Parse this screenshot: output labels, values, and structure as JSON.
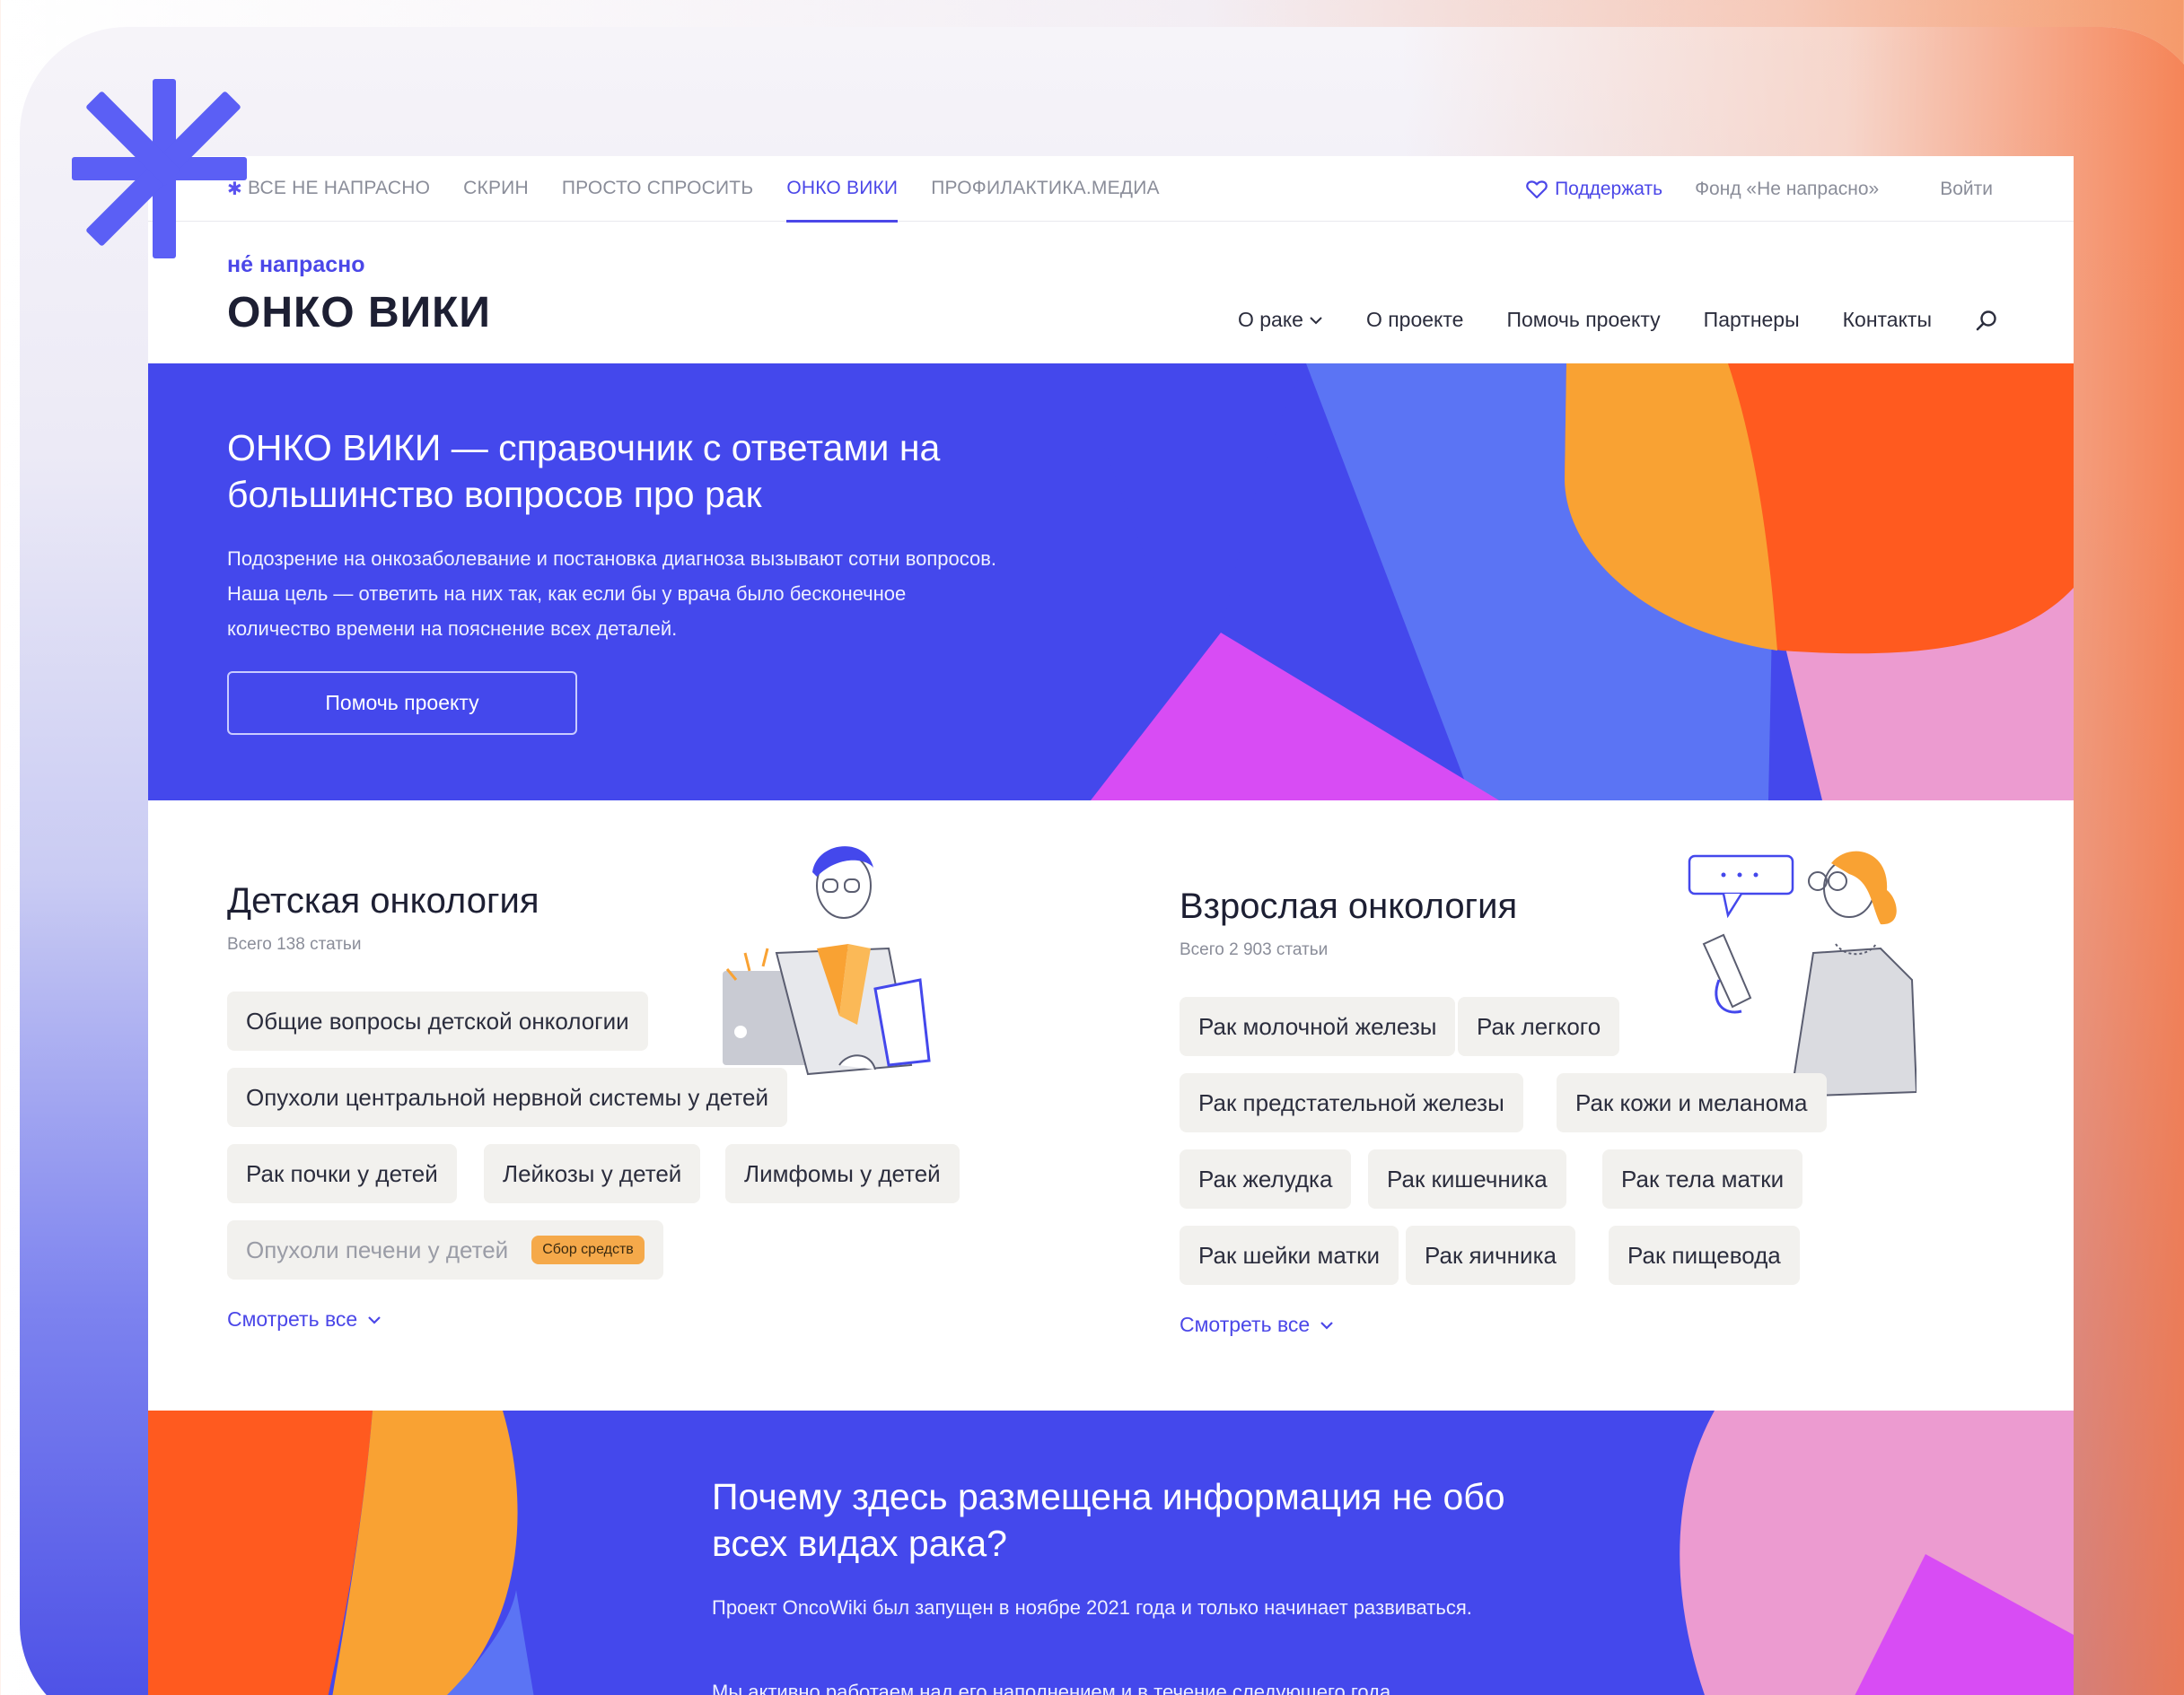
{
  "network": {
    "items": [
      {
        "label": "ВСЕ НЕ НАПРАСНО",
        "active": false
      },
      {
        "label": "СКРИН",
        "active": false
      },
      {
        "label": "ПРОСТО СПРОСИТЬ",
        "active": false
      },
      {
        "label": "ОНКО ВИКИ",
        "active": true
      },
      {
        "label": "ПРОФИЛАКТИКА.МЕДИА",
        "active": false
      }
    ],
    "support": "Поддержать",
    "fund": "Фонд «Не напрасно»",
    "login": "Войти"
  },
  "header": {
    "brand_small": "не́ напрасно",
    "brand_title": "ОНКО ВИКИ",
    "nav": [
      "О раке",
      "О проекте",
      "Помочь проекту",
      "Партнеры",
      "Контакты"
    ]
  },
  "hero": {
    "title": "ОНКО ВИКИ — справочник с ответами на большинство вопросов про рак",
    "text": "Подозрение на онкозаболевание и постановка диагноза вызывают сотни вопросов. Наша цель — ответить на них так, как если бы у врача было бесконечное количество времени на пояснение всех деталей.",
    "button": "Помочь проекту"
  },
  "children": {
    "title": "Детская онкология",
    "count": "Всего 138 статьи",
    "chips": [
      "Общие вопросы детской онкологии",
      "Опухоли центральной нервной системы у детей",
      "Рак почки у детей",
      "Лейкозы у детей",
      "Лимфомы у детей",
      "Опухоли печени у детей"
    ],
    "badge": "Сбор средств",
    "see_all": "Смотреть все"
  },
  "adults": {
    "title": "Взрослая онкология",
    "count": "Всего 2 903 статьи",
    "chips": [
      "Рак молочной железы",
      "Рак легкого",
      "Рак предстательной железы",
      "Рак кожи и меланома",
      "Рак желудка",
      "Рак кишечника",
      "Рак тела матки",
      "Рак шейки матки",
      "Рак яичника",
      "Рак пищевода"
    ],
    "see_all": "Смотреть все"
  },
  "why": {
    "title": "Почему здесь размещена информация не обо всех видах рака?",
    "p1": "Проект OncoWiki был запущен в ноябре 2021 года и только начинает развиваться.",
    "p2": "Мы активно работаем над его наполнением и в течение следующего года"
  },
  "colors": {
    "brand_blue": "#4448ec",
    "accent_blue": "#4b47e8",
    "orange": "#f9a233",
    "red_orange": "#ff5a1f",
    "pink": "#ec9bd0",
    "magenta": "#d84cf4",
    "chip_bg": "#f2f1ee",
    "badge": "#f5a94a"
  },
  "icons": [
    "asterisk-logo-icon",
    "heart-icon",
    "chevron-down-icon",
    "search-icon"
  ]
}
